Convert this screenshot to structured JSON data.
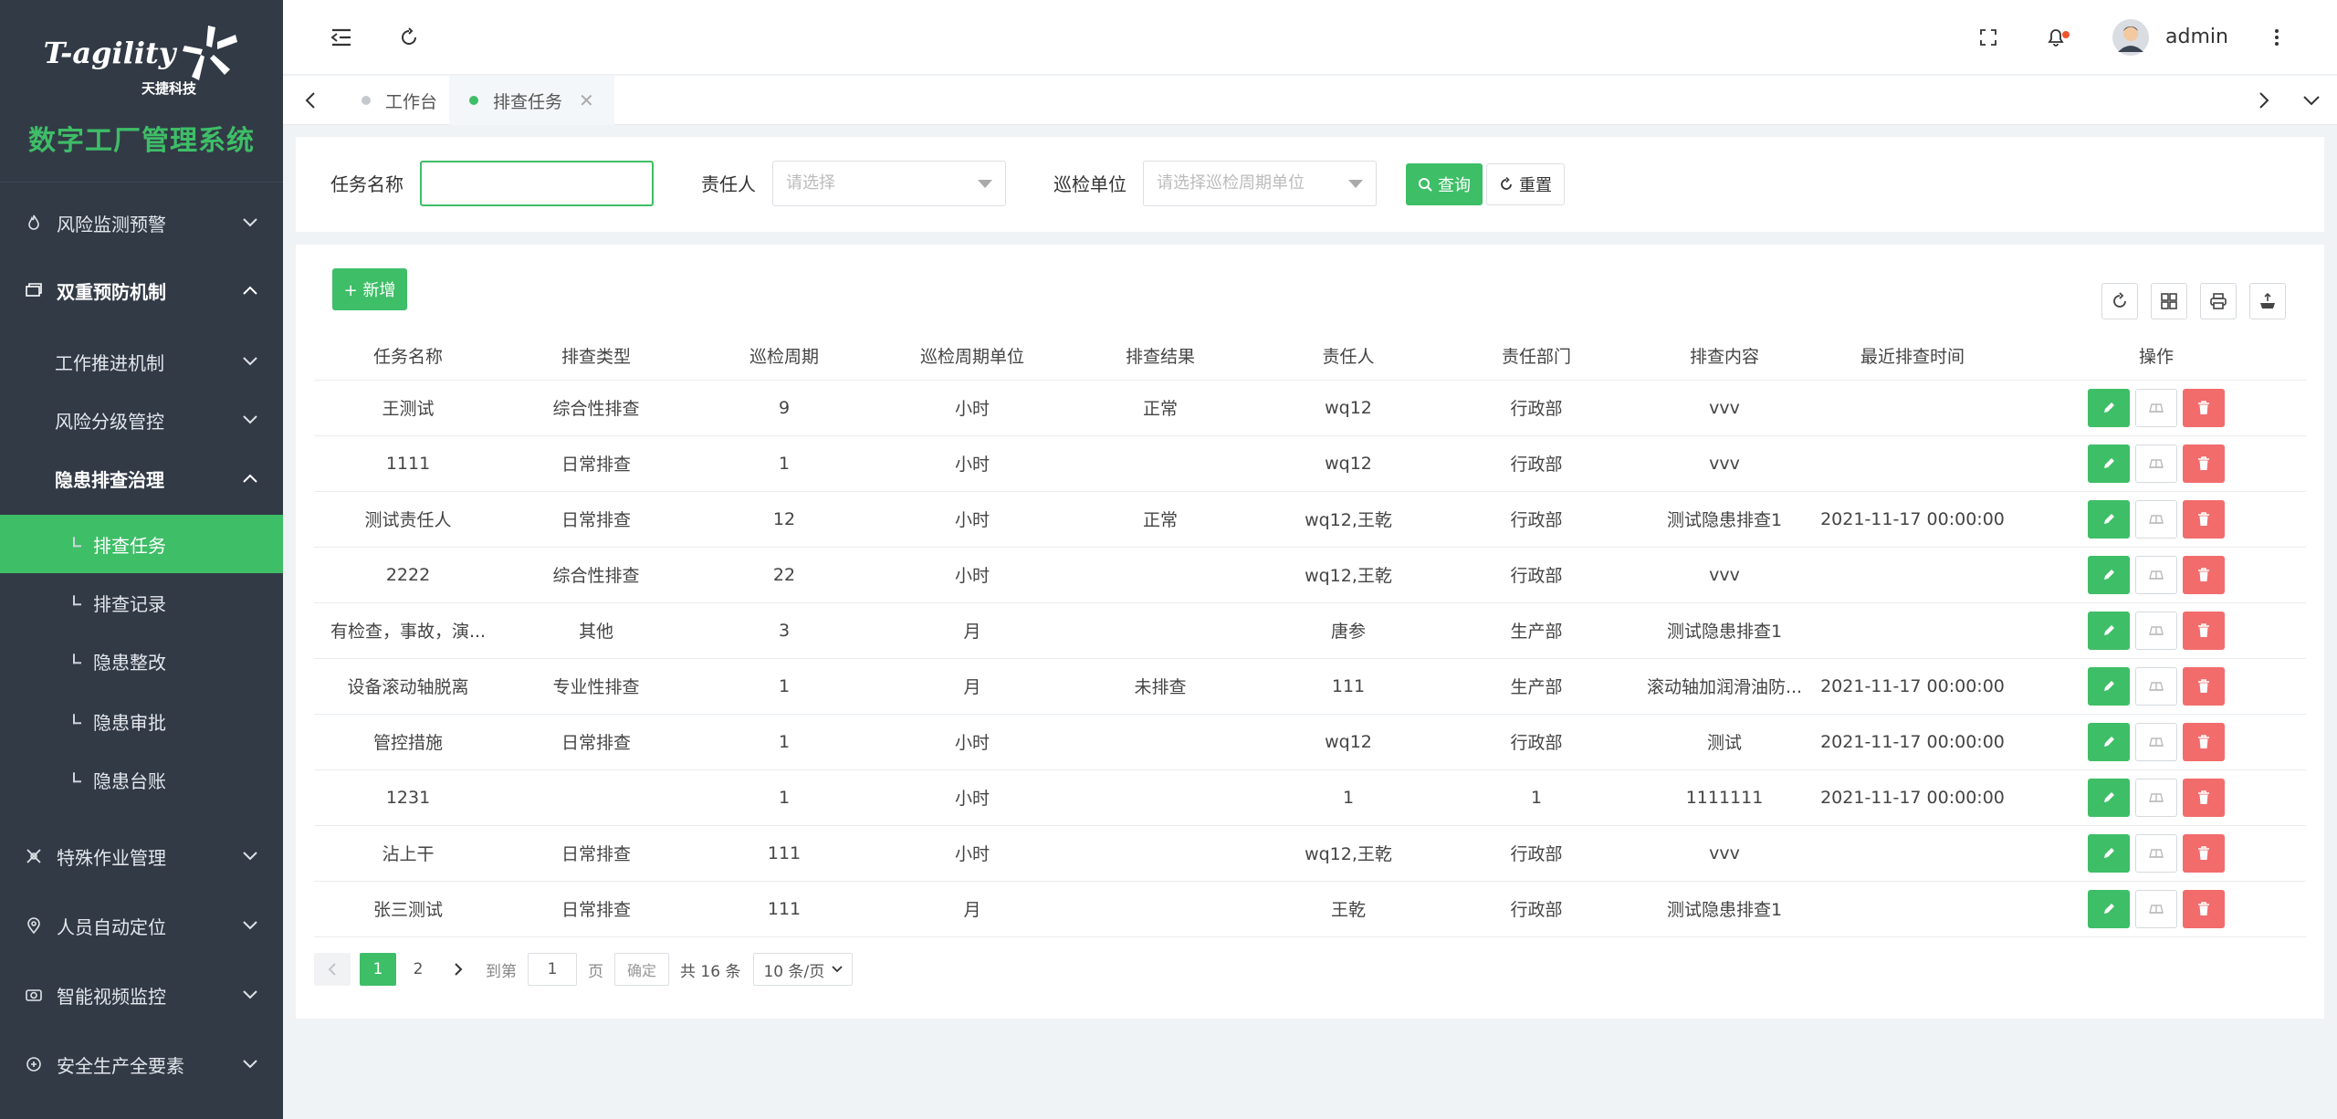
{
  "brand": {
    "logo_text": "T-agility",
    "logo_sub": "天捷科技",
    "system_title": "数字工厂管理系统"
  },
  "sidebar": {
    "items": [
      {
        "label": "风险监测预警",
        "icon": "fire-icon"
      },
      {
        "label": "双重预防机制",
        "icon": "shield-icon"
      },
      {
        "label": "工作推进机制"
      },
      {
        "label": "风险分级管控"
      },
      {
        "label": "隐患排查治理"
      },
      {
        "label": "排查任务"
      },
      {
        "label": "排查记录"
      },
      {
        "label": "隐患整改"
      },
      {
        "label": "隐患审批"
      },
      {
        "label": "隐患台账"
      },
      {
        "label": "特殊作业管理",
        "icon": "tools-icon"
      },
      {
        "label": "人员自动定位",
        "icon": "location-icon"
      },
      {
        "label": "智能视频监控",
        "icon": "camera-icon"
      },
      {
        "label": "安全生产全要素",
        "icon": "elements-icon"
      }
    ]
  },
  "header": {
    "user_name": "admin"
  },
  "tabs": [
    {
      "label": "工作台"
    },
    {
      "label": "排查任务"
    }
  ],
  "search": {
    "task_name_label": "任务名称",
    "task_name_value": "",
    "owner_label": "责任人",
    "owner_placeholder": "请选择",
    "unit_label": "巡检单位",
    "unit_placeholder": "请选择巡检周期单位",
    "query_label": "查询",
    "reset_label": "重置"
  },
  "toolbar": {
    "add_label": "+ 新增"
  },
  "table": {
    "columns": [
      "任务名称",
      "排查类型",
      "巡检周期",
      "巡检周期单位",
      "排查结果",
      "责任人",
      "责任部门",
      "排查内容",
      "最近排查时间",
      "操作"
    ],
    "rows": [
      [
        "王测试",
        "综合性排查",
        "9",
        "小时",
        "正常",
        "wq12",
        "行政部",
        "vvv",
        ""
      ],
      [
        "1111",
        "日常排查",
        "1",
        "小时",
        "",
        "wq12",
        "行政部",
        "vvv",
        ""
      ],
      [
        "测试责任人",
        "日常排查",
        "12",
        "小时",
        "正常",
        "wq12,王乾",
        "行政部",
        "测试隐患排查1",
        "2021-11-17 00:00:00"
      ],
      [
        "2222",
        "综合性排查",
        "22",
        "小时",
        "",
        "wq12,王乾",
        "行政部",
        "vvv",
        ""
      ],
      [
        "有检查，事故，演...",
        "其他",
        "3",
        "月",
        "",
        "唐参",
        "生产部",
        "测试隐患排查1",
        ""
      ],
      [
        "设备滚动轴脱离",
        "专业性排查",
        "1",
        "月",
        "未排查",
        "111",
        "生产部",
        "滚动轴加润滑油防...",
        "2021-11-17 00:00:00"
      ],
      [
        "管控措施",
        "日常排查",
        "1",
        "小时",
        "",
        "wq12",
        "行政部",
        "测试",
        "2021-11-17 00:00:00"
      ],
      [
        "1231",
        "",
        "1",
        "小时",
        "",
        "1",
        "1",
        "1111111",
        "2021-11-17 00:00:00"
      ],
      [
        "沾上干",
        "日常排查",
        "111",
        "小时",
        "",
        "wq12,王乾",
        "行政部",
        "vvv",
        ""
      ],
      [
        "张三测试",
        "日常排查",
        "111",
        "月",
        "",
        "王乾",
        "行政部",
        "测试隐患排查1",
        ""
      ]
    ]
  },
  "pagination": {
    "pages": [
      "1",
      "2"
    ],
    "goto_label": "到第",
    "goto_value": "1",
    "page_suffix": "页",
    "confirm_label": "确定",
    "total_label": "共 16 条",
    "page_size_label": "10 条/页"
  },
  "colors": {
    "accent": "#3ebe67",
    "sidebar_bg": "#323a46",
    "danger": "#f26c6c"
  }
}
